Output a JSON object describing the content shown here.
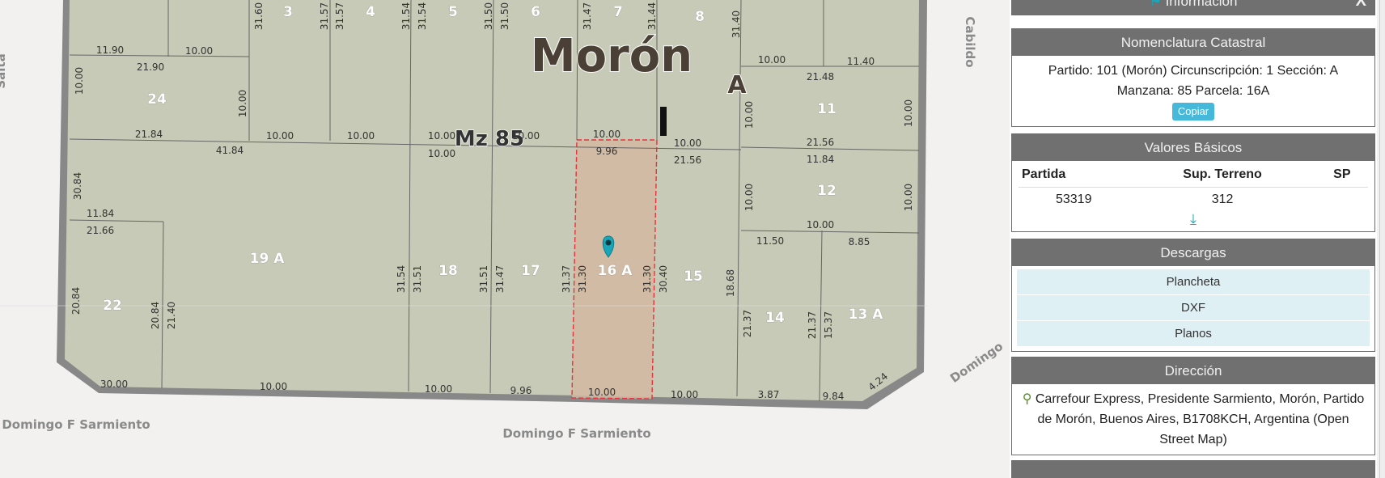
{
  "map": {
    "city_label": "Morón",
    "section_label": "A",
    "block_label": "Mz 85",
    "streets": {
      "bottom_left": "Domingo F Sarmiento",
      "bottom_center": "Domingo F Sarmiento",
      "right_top": "Cabildo",
      "right_bottom": "Domingo",
      "left": "Salta"
    },
    "parcels": [
      "3",
      "4",
      "5",
      "6",
      "7",
      "8",
      "24",
      "11",
      "12",
      "19 A",
      "18",
      "17",
      "16 A",
      "15",
      "22",
      "14",
      "13 A"
    ],
    "dimensions": [
      "11.90",
      "10.00",
      "21.90",
      "10.00",
      "11.40",
      "21.48",
      "21.84",
      "41.84",
      "10.00",
      "10.00",
      "10.00",
      "10.00",
      "10.00",
      "9.96",
      "10.00",
      "10.00",
      "21.56",
      "21.56",
      "11.84",
      "11.84",
      "21.66",
      "10.00",
      "11.50",
      "8.85",
      "30.00",
      "10.00",
      "10.00",
      "9.96",
      "10.00",
      "10.00",
      "3.87",
      "9.84",
      "4.24",
      "31.60",
      "31.57",
      "31.57",
      "31.54",
      "31.54",
      "31.50",
      "31.50",
      "31.47",
      "31.44",
      "31.40",
      "10.00",
      "10.00",
      "10.00",
      "10.00",
      "10.00",
      "10.00",
      "30.84",
      "31.54",
      "31.51",
      "31.51",
      "31.47",
      "31.37",
      "31.30",
      "31.30",
      "30.40",
      "18.68",
      "20.84",
      "20.84",
      "21.40",
      "21.37",
      "21.37",
      "15.37"
    ],
    "accent_color": "#e8323c",
    "marker_color": "#18a6b8",
    "marker_icon": "map-pin-icon"
  },
  "panel": {
    "header_title": "Información",
    "close_label": "X",
    "nomenclatura": {
      "title": "Nomenclatura Catastral",
      "line1": "Partido: 101 (Morón) Circunscripción: 1 Sección: A",
      "line2": "Manzana: 85 Parcela: 16A",
      "copy_label": "Copiar"
    },
    "valores": {
      "title": "Valores Básicos",
      "columns": [
        "Partida",
        "Sup. Terreno",
        "SP"
      ],
      "row": [
        "53319",
        "312",
        ""
      ],
      "download_icon": "download-icon"
    },
    "descargas": {
      "title": "Descargas",
      "items": [
        "Plancheta",
        "DXF",
        "Planos"
      ]
    },
    "direccion": {
      "title": "Dirección",
      "text": "Carrefour Express, Presidente Sarmiento, Morón, Partido de Morón, Buenos Aires, B1708KCH, Argentina (Open Street Map)",
      "icon": "map-search-icon"
    }
  }
}
